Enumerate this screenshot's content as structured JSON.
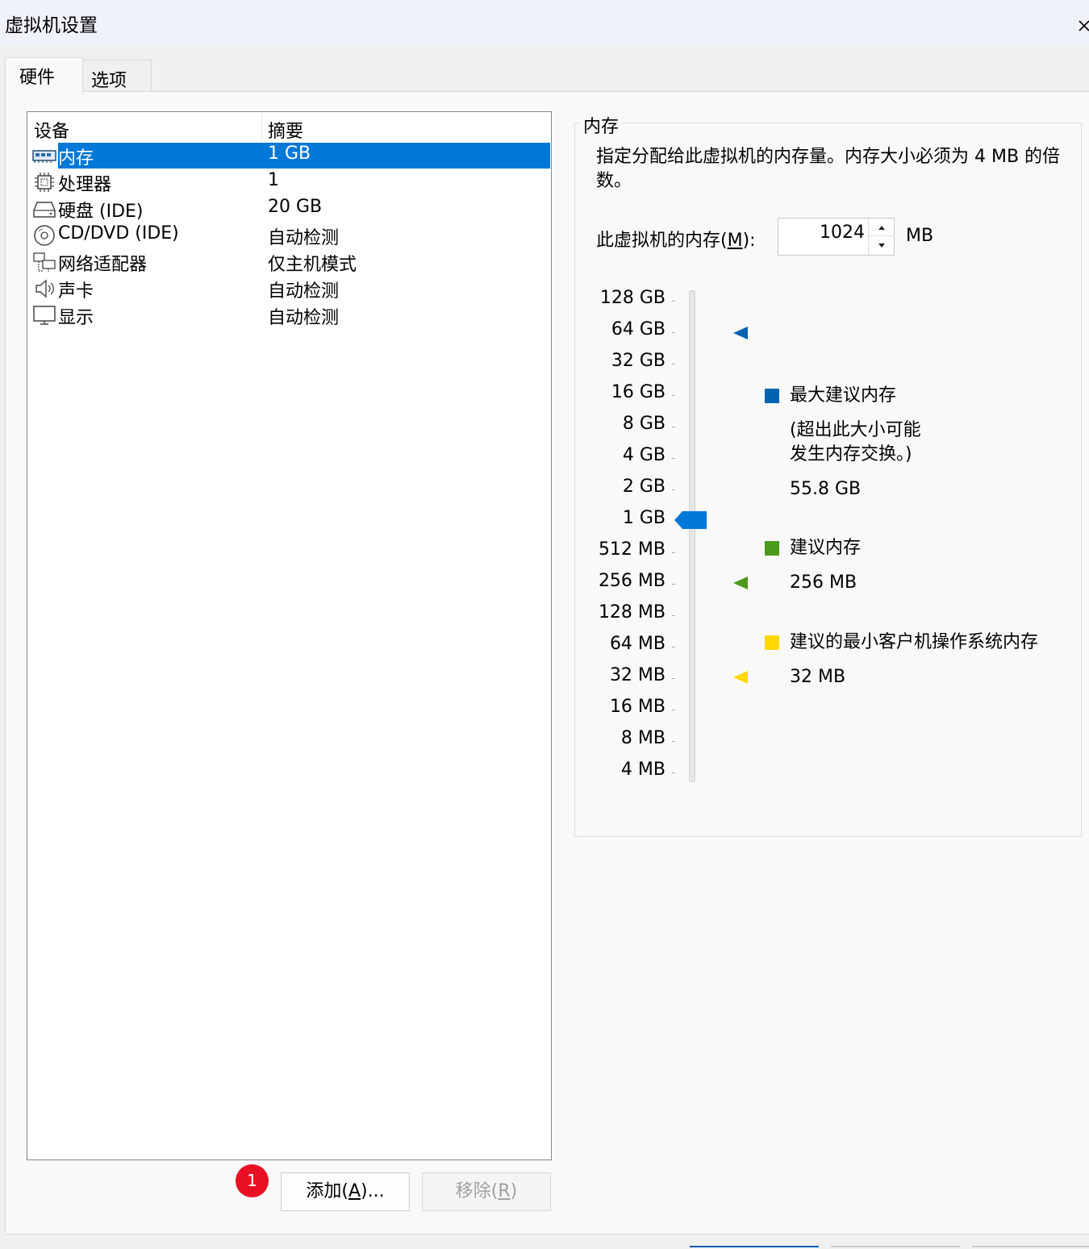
{
  "window": {
    "title": "虚拟机设置"
  },
  "tabs": [
    {
      "label": "硬件",
      "active": true
    },
    {
      "label": "选项",
      "active": false
    }
  ],
  "device_list": {
    "columns": {
      "device": "设备",
      "summary": "摘要"
    },
    "rows": [
      {
        "name": "内存",
        "summary": "1 GB",
        "icon": "memory-icon",
        "selected": true
      },
      {
        "name": "处理器",
        "summary": "1",
        "icon": "processor-icon",
        "selected": false
      },
      {
        "name": "硬盘 (IDE)",
        "summary": "20 GB",
        "icon": "hard-disk-icon",
        "selected": false
      },
      {
        "name": "CD/DVD (IDE)",
        "summary": "自动检测",
        "icon": "cd-dvd-icon",
        "selected": false
      },
      {
        "name": "网络适配器",
        "summary": "仅主机模式",
        "icon": "network-adapter-icon",
        "selected": false
      },
      {
        "name": "声卡",
        "summary": "自动检测",
        "icon": "sound-card-icon",
        "selected": false
      },
      {
        "name": "显示",
        "summary": "自动检测",
        "icon": "display-icon",
        "selected": false
      }
    ]
  },
  "badge": "1",
  "buttons": {
    "add": "添加(A)...",
    "add_text": "添加(",
    "add_key": "A",
    "add_tail": ")...",
    "remove": "移除(R)",
    "remove_text": "移除(",
    "remove_key": "R",
    "remove_tail": ")"
  },
  "memory": {
    "group_label": "内存",
    "description": "指定分配给此虚拟机的内存量。内存大小必须为 4 MB 的倍数。",
    "field_label": "此虚拟机的内存(M):",
    "field_label_text": "此虚拟机的内存(",
    "field_label_key": "M",
    "field_label_tail": "):",
    "value": "1024",
    "unit": "MB",
    "scale": [
      "128 GB",
      "64 GB",
      "32 GB",
      "16 GB",
      "8 GB",
      "4 GB",
      "2 GB",
      "1 GB",
      "512 MB",
      "256 MB",
      "128 MB",
      "64 MB",
      "32 MB",
      "16 MB",
      "8 MB",
      "4 MB"
    ],
    "current": "1 GB",
    "legend": {
      "max_recommended": {
        "title": "最大建议内存",
        "note_line1": "(超出此大小可能",
        "note_line2": "发生内存交换。)",
        "value": "55.8 GB",
        "marker_at": "64 GB",
        "color": "#0063b1"
      },
      "recommended": {
        "title": "建议内存",
        "value": "256 MB",
        "marker_at": "256 MB",
        "color": "#4b9a1b"
      },
      "min_guest_os": {
        "title": "建议的最小客户机操作系统内存",
        "value": "32 MB",
        "marker_at": "32 MB",
        "color": "#ffd800"
      }
    },
    "thumb_color": "#0078d7"
  }
}
